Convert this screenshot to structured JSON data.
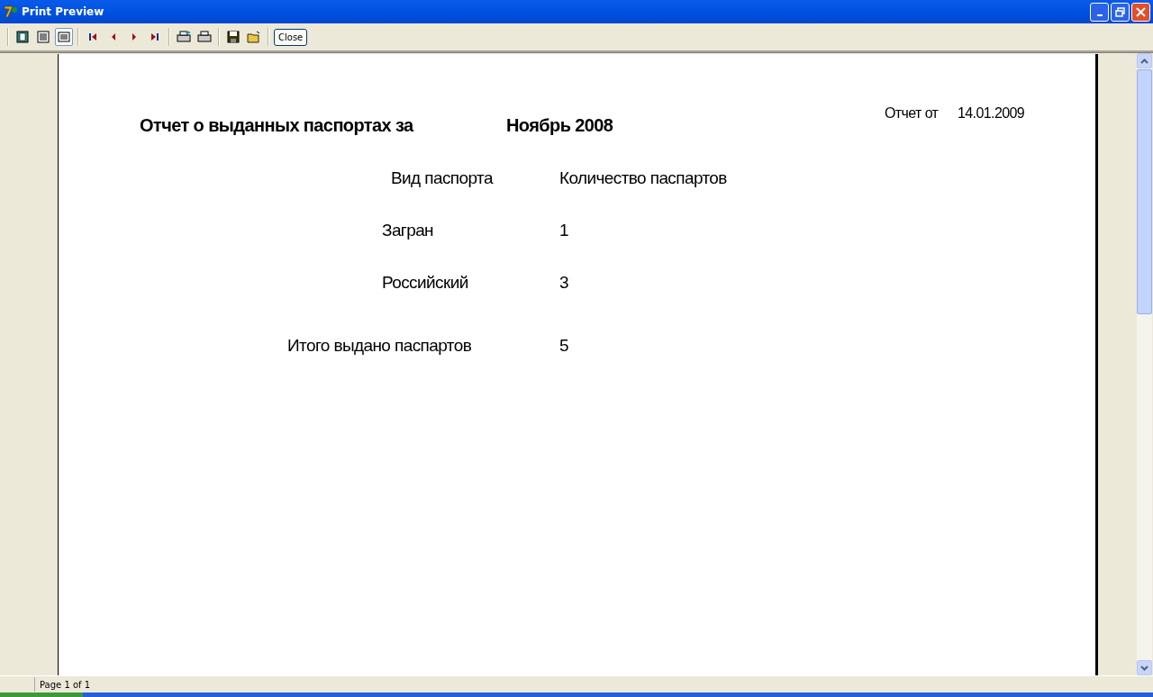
{
  "window": {
    "title": "Print Preview"
  },
  "toolbar": {
    "view_modes": [
      {
        "selected": false
      },
      {
        "selected": false
      },
      {
        "selected": true
      }
    ],
    "close_button": "Close"
  },
  "report": {
    "date_label": "Отчет от",
    "date": "14.01.2009",
    "title": "Отчет о выданных паспортах за",
    "period": "Ноябрь 2008",
    "columns": [
      "Вид паспорта",
      "Количество паспартов"
    ],
    "rows": [
      {
        "type": "Загран",
        "count": "1"
      },
      {
        "type": "Российский",
        "count": "3"
      }
    ],
    "total_label": "Итого выдано паспартов",
    "total": "5"
  },
  "status_bar": {
    "page": "Page 1 of 1"
  }
}
